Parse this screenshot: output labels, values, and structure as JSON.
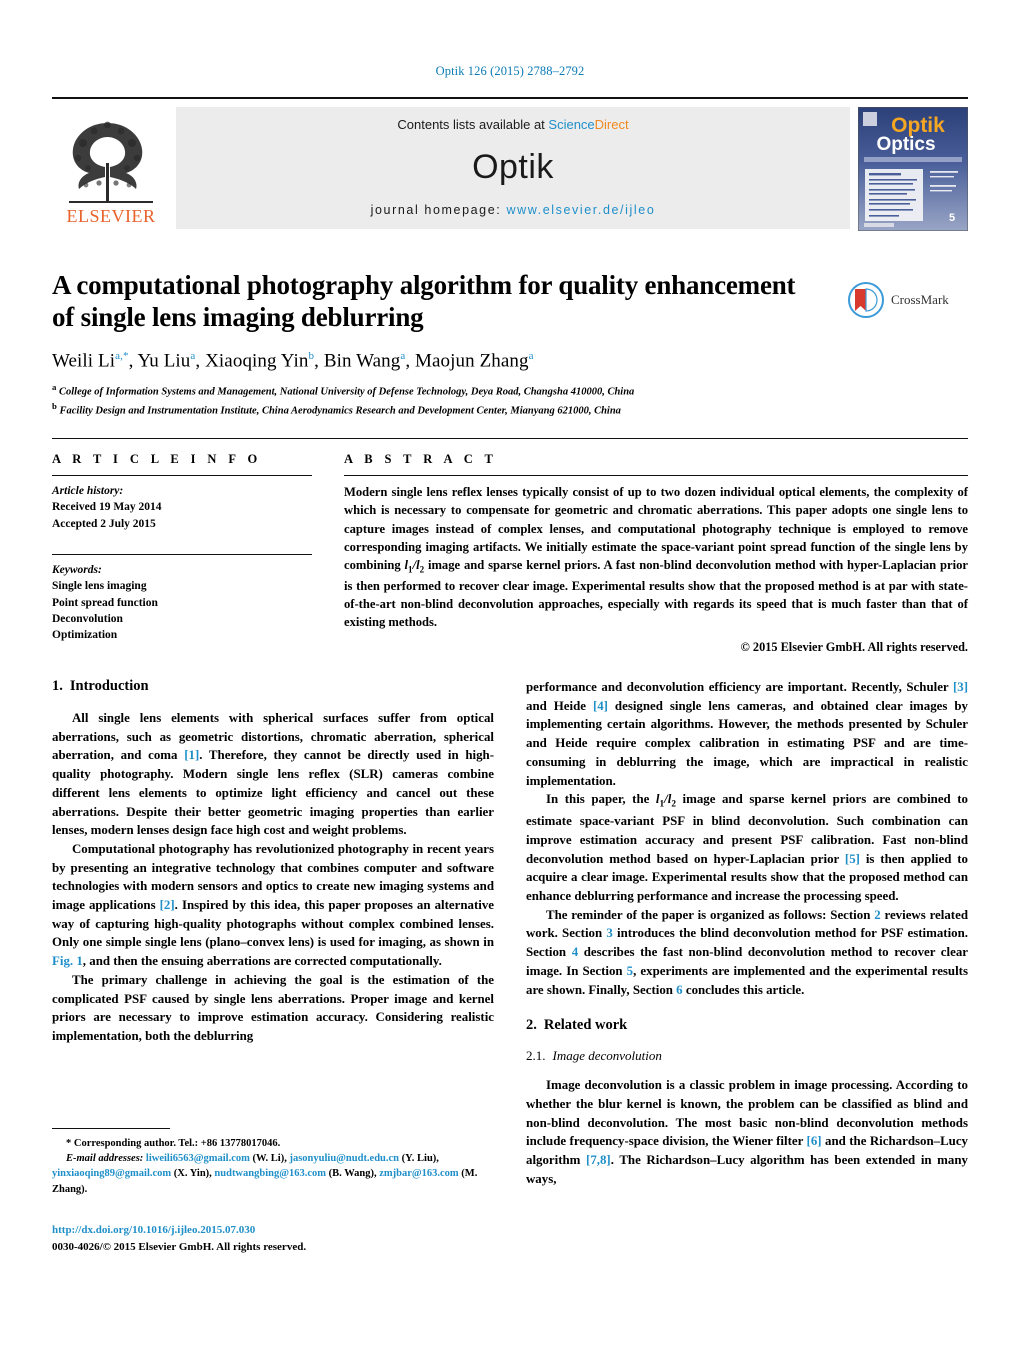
{
  "running_head": "Optik 126 (2015) 2788–2792",
  "masthead": {
    "publisher_name": "ELSEVIER",
    "contents_prefix": "Contents lists available at ",
    "sciencedirect_science": "Science",
    "sciencedirect_direct": "Direct",
    "journal_name": "Optik",
    "homepage_label": "journal homepage:",
    "homepage_url": "www.elsevier.de/ijleo",
    "cover_title_top": "Optik",
    "cover_title_bottom": "Optics",
    "cover_issue": "5"
  },
  "article": {
    "title": "A computational photography algorithm for quality enhancement of single lens imaging deblurring",
    "crossmark_label": "CrossMark",
    "authors_html": "Weili Li<sup>a,*</sup>, Yu Liu<sup>a</sup>, Xiaoqing Yin<sup>b</sup>, Bin Wang<sup>a</sup>, Maojun Zhang<sup>a</sup>",
    "authors_plain": "Weili Li a,*, Yu Liu a, Xiaoqing Yin b, Bin Wang a, Maojun Zhang a",
    "affiliation_a": "College of Information Systems and Management, National University of Defense Technology, Deya Road, Changsha 410000, China",
    "affiliation_b": "Facility Design and Instrumentation Institute, China Aerodynamics Research and Development Center, Mianyang 621000, China",
    "affiliation_a_marker": "a",
    "affiliation_b_marker": "b"
  },
  "article_info": {
    "heading": "A R T I C L E    I N F O",
    "history_label": "Article history:",
    "received": "Received 19 May 2014",
    "accepted": "Accepted 2 July 2015",
    "keywords_label": "Keywords:",
    "keywords": [
      "Single lens imaging",
      "Point spread function",
      "Deconvolution",
      "Optimization"
    ]
  },
  "abstract": {
    "heading": "A B S T R A C T",
    "part1": "Modern single lens reflex lenses typically consist of up to two dozen individual optical elements, the complexity of which is necessary to compensate for geometric and chromatic aberrations. This paper adopts one single lens to capture images instead of complex lenses, and computational photography technique is employed to remove corresponding imaging artifacts. We initially estimate the space-variant point spread function of the single lens by combining ",
    "math_l1": "l",
    "math_sub1": "1",
    "math_slash": "/",
    "math_l2": "l",
    "math_sub2": "2",
    "part2": " image and sparse kernel priors. A fast non-blind deconvolution method with hyper-Laplacian prior is then performed to recover clear image. Experimental results show that the proposed method is at par with state-of-the-art non-blind deconvolution approaches, especially with regards its speed that is much faster than that of existing methods.",
    "copyright": "© 2015 Elsevier GmbH. All rights reserved."
  },
  "sections": {
    "intro": {
      "num": "1.",
      "title": "Introduction",
      "p1_a": "All single lens elements with spherical surfaces suffer from optical aberrations, such as geometric distortions, chromatic aberration, spherical aberration, and coma ",
      "p1_ref": "[1]",
      "p1_b": ". Therefore, they cannot be directly used in high-quality photography. Modern single lens reflex (SLR) cameras combine different lens elements to optimize light efficiency and cancel out these aberrations. Despite their better geometric imaging properties than earlier lenses, modern lenses design face high cost and weight problems.",
      "p2_a": "Computational photography has revolutionized photography in recent years by presenting an integrative technology that combines computer and software technologies with modern sensors and optics to create new imaging systems and image applications ",
      "p2_ref": "[2]",
      "p2_b": ". Inspired by this idea, this paper proposes an alternative way of capturing high-quality photographs without complex combined lenses. Only one simple single lens (plano–convex lens) is used for imaging, as shown in ",
      "p2_figref": "Fig. 1",
      "p2_c": ", and then the ensuing aberrations are corrected computationally.",
      "p3": "The primary challenge in achieving the goal is the estimation of the complicated PSF caused by single lens aberrations. Proper image and kernel priors are necessary to improve estimation accuracy. Considering realistic implementation, both the deblurring"
    },
    "right_col": {
      "p1_a": "performance and deconvolution efficiency are important. Recently, Schuler ",
      "p1_ref1": "[3]",
      "p1_b": " and Heide ",
      "p1_ref2": "[4]",
      "p1_c": " designed single lens cameras, and obtained clear images by implementing certain algorithms. However, the methods presented by Schuler and Heide require complex calibration in estimating PSF and are time-consuming in deblurring the image, which are impractical in realistic implementation.",
      "p2_a": "In this paper, the ",
      "p2_b": " image and sparse kernel priors are combined to estimate space-variant PSF in blind deconvolution. Such combination can improve estimation accuracy and present PSF calibration. Fast non-blind deconvolution method based on hyper-Laplacian prior ",
      "p2_ref": "[5]",
      "p2_c": " is then applied to acquire a clear image. Experimental results show that the proposed method can enhance deblurring performance and increase the processing speed.",
      "p3_a": "The reminder of the paper is organized as follows: Section ",
      "p3_s2": "2",
      "p3_b": " reviews related work. Section ",
      "p3_s3": "3",
      "p3_c": " introduces the blind deconvolution method for PSF estimation. Section ",
      "p3_s4": "4",
      "p3_d": " describes the fast non-blind deconvolution method to recover clear image. In Section ",
      "p3_s5": "5",
      "p3_e": ", experiments are implemented and the experimental results are shown. Finally, Section ",
      "p3_s6": "6",
      "p3_f": " concludes this article."
    },
    "related": {
      "num": "2.",
      "title": "Related work",
      "sub_num": "2.1.",
      "sub_title": "Image deconvolution",
      "p1_a": "Image deconvolution is a classic problem in image processing. According to whether the blur kernel is known, the problem can be classified as blind and non-blind deconvolution. The most basic non-blind deconvolution methods include frequency-space division, the Wiener filter ",
      "p1_ref1": "[6]",
      "p1_b": " and the Richardson–Lucy algorithm ",
      "p1_ref2": "[7,8]",
      "p1_c": ". The Richardson–Lucy algorithm has been extended in many ways,"
    }
  },
  "footnote": {
    "corresponding": "* Corresponding author. Tel.: +86 13778017046.",
    "email_label": "E-mail addresses:",
    "emails": [
      {
        "address": "liweili6563@gmail.com",
        "owner": "(W. Li),"
      },
      {
        "address": "jasonyuliu@nudt.edu.cn",
        "owner": "(Y. Liu),"
      },
      {
        "address": "yinxiaoqing89@gmail.com",
        "owner": "(X. Yin),"
      },
      {
        "address": "nudtwangbing@163.com",
        "owner": "(B. Wang),"
      },
      {
        "address": "zmjbar@163.com",
        "owner": "(M. Zhang)."
      }
    ]
  },
  "bottom": {
    "doi": "http://dx.doi.org/10.1016/j.ijleo.2015.07.030",
    "issn_copyright": "0030-4026/© 2015 Elsevier GmbH. All rights reserved."
  },
  "colors": {
    "link_blue": "#1f8fc9",
    "elsevier_orange": "#e8622a",
    "running_head_blue": "#0b7bb5",
    "masthead_grey": "#ececed"
  }
}
